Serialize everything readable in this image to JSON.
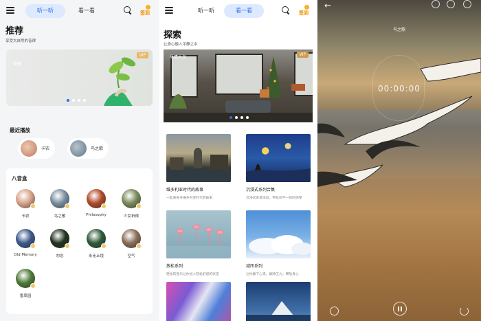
{
  "screen1": {
    "tabs": [
      {
        "label": "听一听",
        "active": true
      },
      {
        "label": "看一看",
        "active": false
      }
    ],
    "signin_label": "签到",
    "title": "推荐",
    "subtitle": "享受大自然的音律",
    "banner": {
      "label": "安睡",
      "badge": "VIP",
      "dots": 4,
      "active_dot": 0
    },
    "recent_title": "最近播放",
    "recent": [
      {
        "label": "卡农"
      },
      {
        "label": "鸟之歌"
      }
    ],
    "box_title": "八音盒",
    "box_items": [
      {
        "label": "卡农",
        "color": "#d8a48c"
      },
      {
        "label": "鸟之歌",
        "color": "#7a8fa0"
      },
      {
        "label": "Philosophy",
        "color": "#b04a2a"
      },
      {
        "label": "少女祈祷",
        "color": "#7a8a5a"
      },
      {
        "label": "Old Memory",
        "color": "#3d5a8a"
      },
      {
        "label": "勿念",
        "color": "#223322"
      },
      {
        "label": "永无止境",
        "color": "#2f5a3a"
      },
      {
        "label": "空气",
        "color": "#8a6e5a"
      },
      {
        "label": "香草园",
        "color": "#4f7a3a"
      }
    ]
  },
  "screen2": {
    "tabs": [
      {
        "label": "听一听",
        "active": false
      },
      {
        "label": "看一看",
        "active": true
      }
    ],
    "signin_label": "签到",
    "title": "探索",
    "subtitle": "让身心融入平静之中",
    "banner": {
      "label": "纵情大海",
      "badge": "VIP",
      "dots": 4,
      "active_dot": 0
    },
    "cards": [
      {
        "title": "维多利亚时代的故事",
        "desc": "一起来探寻维多利亚时代的故事"
      },
      {
        "title": "沉浸式系列合集",
        "desc": "沉浸式声景体验，带给你不一样的感受"
      },
      {
        "title": "放松系列",
        "desc": "轻松的音乐让你进入轻松舒适的状态"
      },
      {
        "title": "减压系列",
        "desc": "让你静下心来，解除压力，释放身心"
      },
      {
        "title": "",
        "desc": ""
      },
      {
        "title": "",
        "desc": ""
      }
    ]
  },
  "screen3": {
    "track_title": "鸟之歌",
    "timer": "00:00:00"
  }
}
